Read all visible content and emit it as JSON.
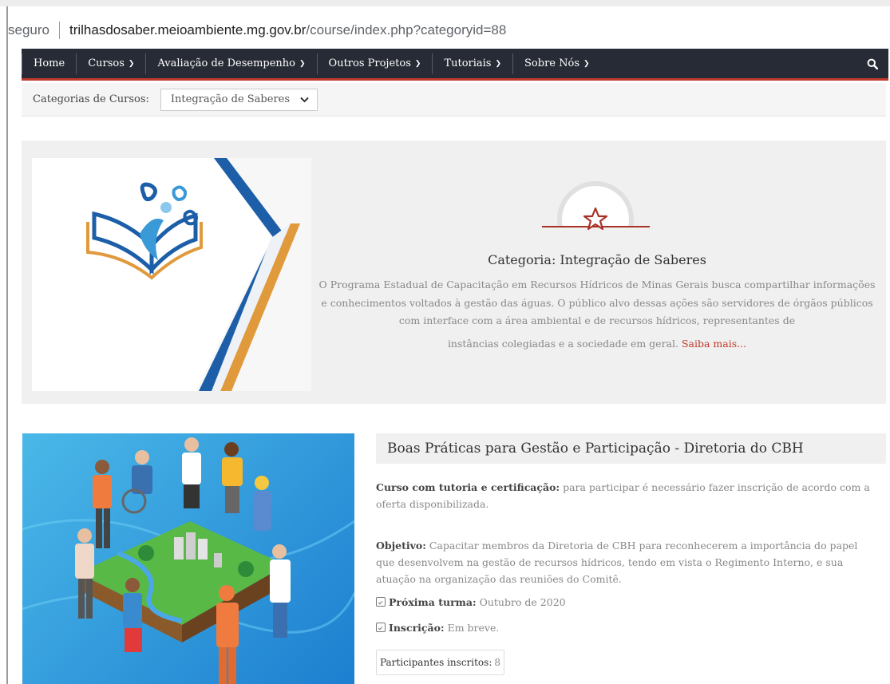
{
  "browser": {
    "security_label": "seguro",
    "url_host": "trilhasdosaber.meioambiente.mg.gov.br",
    "url_path": "/course/index.php?categoryid=88"
  },
  "nav": {
    "items": [
      {
        "label": "Home",
        "dropdown": false
      },
      {
        "label": "Cursos",
        "dropdown": true
      },
      {
        "label": "Avaliação de Desempenho",
        "dropdown": true
      },
      {
        "label": "Outros Projetos",
        "dropdown": true
      },
      {
        "label": "Tutoriais",
        "dropdown": true
      },
      {
        "label": "Sobre Nós",
        "dropdown": true
      }
    ],
    "search_icon": "search-icon",
    "accent": "#c0392b",
    "background": "#272b35"
  },
  "category_bar": {
    "label": "Categorias de Cursos:",
    "selected": "Integração de Saberes"
  },
  "category": {
    "title": "Categoria: Integração de Saberes",
    "description": "O Programa Estadual de Capacitação em Recursos Hídricos de Minas Gerais busca compartilhar informações e conhecimentos voltados à gestão das águas. O público alvo dessas ações são servidores de órgãos públicos com interface com a área ambiental e de recursos hídricos, representantes de",
    "description_2": "instâncias colegiadas e a sociedade em geral.",
    "more_link": "Saiba mais..."
  },
  "course": {
    "title": "Boas Práticas para Gestão e Participação - Diretoria do CBH",
    "tutoria_label": "Curso com tutoria e certificação:",
    "tutoria_text": "para participar é necessário fazer inscrição de acordo com a oferta disponibilizada.",
    "objetivo_label": "Objetivo:",
    "objetivo_text": "Capacitar membros da Diretoria de CBH para reconhecerem a importância do papel que desenvolvem na gestão de recursos hídricos, tendo em vista o Regimento Interno,  e sua atuação na organização das reuniões do Comitê.",
    "proxima_label": "Próxima turma:",
    "proxima_value": "Outubro de 2020",
    "inscricao_label": "Inscrição:",
    "inscricao_value": "Em breve.",
    "participants_label": "Participantes inscritos:",
    "participants_count": "8"
  }
}
